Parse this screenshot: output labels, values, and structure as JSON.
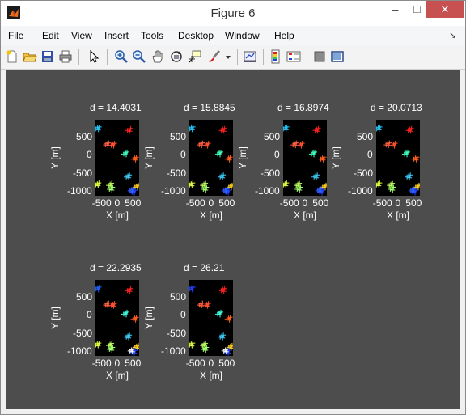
{
  "window": {
    "title": "Figure 6",
    "controls": {
      "minimize": "–",
      "maximize": "□",
      "close": "✕"
    }
  },
  "menu": {
    "items": [
      "File",
      "Edit",
      "View",
      "Insert",
      "Tools",
      "Desktop",
      "Window",
      "Help"
    ],
    "dock_icon": "dock-arrow-icon"
  },
  "toolbar": {
    "buttons": [
      "new-figure-icon",
      "open-file-icon",
      "save-icon",
      "print-icon",
      "edit-plot-arrow-icon",
      "zoom-in-icon",
      "zoom-out-icon",
      "pan-hand-icon",
      "rotate-3d-icon",
      "data-cursor-icon",
      "brush-icon",
      "brush-dropdown-icon",
      "link-plot-icon",
      "insert-colorbar-icon",
      "insert-legend-icon",
      "hide-plot-tools-icon",
      "show-plot-tools-icon"
    ]
  },
  "figure": {
    "background": "#4d4d4d",
    "plot_background": "#000000",
    "text_color": "#ffffff"
  },
  "chart_data": [
    {
      "type": "scatter",
      "title": "d = 14.4031",
      "xlabel": "X [m]",
      "ylabel": "Y [m]",
      "xticks": [
        "-500",
        "0",
        "500"
      ],
      "yticks": [
        "500",
        "0",
        "-500",
        "-1000"
      ],
      "xlim": [
        -700,
        700
      ],
      "ylim": [
        -1130,
        960
      ],
      "points": [
        {
          "x": -630,
          "y": 740,
          "color": "#22ccff"
        },
        {
          "x": 380,
          "y": 700,
          "color": "#ff2020"
        },
        {
          "x": -330,
          "y": 300,
          "color": "#ff6040"
        },
        {
          "x": -140,
          "y": 290,
          "color": "#ff5030"
        },
        {
          "x": 260,
          "y": 50,
          "color": "#40ffc0"
        },
        {
          "x": 560,
          "y": -90,
          "color": "#ff6020"
        },
        {
          "x": 340,
          "y": -580,
          "color": "#40d0ff"
        },
        {
          "x": -640,
          "y": -800,
          "color": "#e0ff40"
        },
        {
          "x": -230,
          "y": -810,
          "color": "#c0ff60"
        },
        {
          "x": -200,
          "y": -920,
          "color": "#a0ff70"
        },
        {
          "x": 620,
          "y": -860,
          "color": "#ffd020"
        },
        {
          "x": 520,
          "y": -1000,
          "color": "#2040ff"
        },
        {
          "x": 460,
          "y": -960,
          "color": "#3060ff"
        }
      ]
    },
    {
      "type": "scatter",
      "title": "d = 15.8845",
      "xlabel": "X [m]",
      "ylabel": "Y [m]",
      "xticks": [
        "-500",
        "0",
        "500"
      ],
      "yticks": [
        "500",
        "0",
        "-500",
        "-1000"
      ],
      "xlim": [
        -700,
        700
      ],
      "ylim": [
        -1130,
        960
      ],
      "points": [
        {
          "x": -630,
          "y": 740,
          "color": "#22ccff"
        },
        {
          "x": 380,
          "y": 700,
          "color": "#ff2020"
        },
        {
          "x": -330,
          "y": 300,
          "color": "#ff6040"
        },
        {
          "x": -140,
          "y": 290,
          "color": "#ff5030"
        },
        {
          "x": 260,
          "y": 50,
          "color": "#40ffc0"
        },
        {
          "x": 560,
          "y": -90,
          "color": "#ff6020"
        },
        {
          "x": 340,
          "y": -580,
          "color": "#40d0ff"
        },
        {
          "x": -640,
          "y": -800,
          "color": "#e0ff40"
        },
        {
          "x": -230,
          "y": -810,
          "color": "#c0ff60"
        },
        {
          "x": -200,
          "y": -920,
          "color": "#a0ff70"
        },
        {
          "x": 620,
          "y": -860,
          "color": "#ffd020"
        },
        {
          "x": 520,
          "y": -1000,
          "color": "#2040ff"
        },
        {
          "x": 460,
          "y": -960,
          "color": "#3060ff"
        }
      ]
    },
    {
      "type": "scatter",
      "title": "d = 16.8974",
      "xlabel": "X [m]",
      "ylabel": "Y [m]",
      "xticks": [
        "-500",
        "0",
        "500"
      ],
      "yticks": [
        "500",
        "0",
        "-500",
        "-1000"
      ],
      "xlim": [
        -700,
        700
      ],
      "ylim": [
        -1130,
        960
      ],
      "points": [
        {
          "x": -630,
          "y": 740,
          "color": "#22ccff"
        },
        {
          "x": 380,
          "y": 700,
          "color": "#ff2020"
        },
        {
          "x": -330,
          "y": 300,
          "color": "#ff6040"
        },
        {
          "x": -140,
          "y": 290,
          "color": "#ff5030"
        },
        {
          "x": 260,
          "y": 50,
          "color": "#40ffc0"
        },
        {
          "x": 560,
          "y": -90,
          "color": "#ff6020"
        },
        {
          "x": 340,
          "y": -580,
          "color": "#40d0ff"
        },
        {
          "x": -640,
          "y": -800,
          "color": "#e0ff40"
        },
        {
          "x": -230,
          "y": -810,
          "color": "#c0ff60"
        },
        {
          "x": -200,
          "y": -920,
          "color": "#a0ff70"
        },
        {
          "x": 620,
          "y": -860,
          "color": "#ffd020"
        },
        {
          "x": 520,
          "y": -1000,
          "color": "#2040ff"
        },
        {
          "x": 460,
          "y": -960,
          "color": "#3060ff"
        }
      ]
    },
    {
      "type": "scatter",
      "title": "d = 20.0713",
      "xlabel": "X [m]",
      "ylabel": "Y [m]",
      "xticks": [
        "-500",
        "0",
        "500"
      ],
      "yticks": [
        "500",
        "0",
        "-500",
        "-1000"
      ],
      "xlim": [
        -700,
        700
      ],
      "ylim": [
        -1130,
        960
      ],
      "points": [
        {
          "x": -630,
          "y": 740,
          "color": "#22ccff"
        },
        {
          "x": 380,
          "y": 700,
          "color": "#ff2020"
        },
        {
          "x": -330,
          "y": 300,
          "color": "#ff6040"
        },
        {
          "x": -140,
          "y": 290,
          "color": "#ff5030"
        },
        {
          "x": 260,
          "y": 50,
          "color": "#40ffc0"
        },
        {
          "x": 560,
          "y": -90,
          "color": "#ff6020"
        },
        {
          "x": 340,
          "y": -580,
          "color": "#40d0ff"
        },
        {
          "x": -640,
          "y": -800,
          "color": "#e0ff40"
        },
        {
          "x": -230,
          "y": -810,
          "color": "#c0ff60"
        },
        {
          "x": -200,
          "y": -920,
          "color": "#a0ff70"
        },
        {
          "x": 620,
          "y": -860,
          "color": "#ffd020"
        },
        {
          "x": 520,
          "y": -1000,
          "color": "#2040ff"
        },
        {
          "x": 460,
          "y": -960,
          "color": "#3060ff"
        }
      ]
    },
    {
      "type": "scatter",
      "title": "d = 22.2935",
      "xlabel": "X [m]",
      "ylabel": "Y [m]",
      "xticks": [
        "-500",
        "0",
        "500"
      ],
      "yticks": [
        "500",
        "0",
        "-500",
        "-1000"
      ],
      "xlim": [
        -700,
        700
      ],
      "ylim": [
        -1130,
        960
      ],
      "points": [
        {
          "x": -630,
          "y": 740,
          "color": "#2060ff"
        },
        {
          "x": 380,
          "y": 700,
          "color": "#ff2020"
        },
        {
          "x": -330,
          "y": 300,
          "color": "#ff6040"
        },
        {
          "x": -140,
          "y": 290,
          "color": "#ff5030"
        },
        {
          "x": 260,
          "y": 50,
          "color": "#40ffe0"
        },
        {
          "x": 560,
          "y": -90,
          "color": "#ff6020"
        },
        {
          "x": 340,
          "y": -580,
          "color": "#40d0ff"
        },
        {
          "x": -640,
          "y": -800,
          "color": "#e0ff40"
        },
        {
          "x": -230,
          "y": -810,
          "color": "#c0ff60"
        },
        {
          "x": -200,
          "y": -920,
          "color": "#a0ff70"
        },
        {
          "x": 620,
          "y": -860,
          "color": "#ffd020"
        },
        {
          "x": 520,
          "y": -1000,
          "color": "#2040ff"
        },
        {
          "x": 460,
          "y": -960,
          "color": "#ffffff"
        }
      ]
    },
    {
      "type": "scatter",
      "title": "d = 26.21",
      "xlabel": "X [m]",
      "ylabel": "Y [m]",
      "xticks": [
        "-500",
        "0",
        "500"
      ],
      "yticks": [
        "500",
        "0",
        "-500",
        "-1000"
      ],
      "xlim": [
        -700,
        700
      ],
      "ylim": [
        -1130,
        960
      ],
      "points": [
        {
          "x": -630,
          "y": 740,
          "color": "#2040ff"
        },
        {
          "x": 380,
          "y": 700,
          "color": "#ff2020"
        },
        {
          "x": -330,
          "y": 300,
          "color": "#ff6040"
        },
        {
          "x": -140,
          "y": 290,
          "color": "#ff5030"
        },
        {
          "x": 260,
          "y": 50,
          "color": "#40ffe0"
        },
        {
          "x": 560,
          "y": -90,
          "color": "#ff6020"
        },
        {
          "x": 340,
          "y": -580,
          "color": "#40d0ff"
        },
        {
          "x": -640,
          "y": -800,
          "color": "#e0ff40"
        },
        {
          "x": -230,
          "y": -810,
          "color": "#c0ff60"
        },
        {
          "x": -200,
          "y": -920,
          "color": "#a0ff70"
        },
        {
          "x": 620,
          "y": -860,
          "color": "#ffd020"
        },
        {
          "x": 520,
          "y": -1000,
          "color": "#2040ff"
        },
        {
          "x": 460,
          "y": -960,
          "color": "#ffffff"
        }
      ]
    }
  ]
}
